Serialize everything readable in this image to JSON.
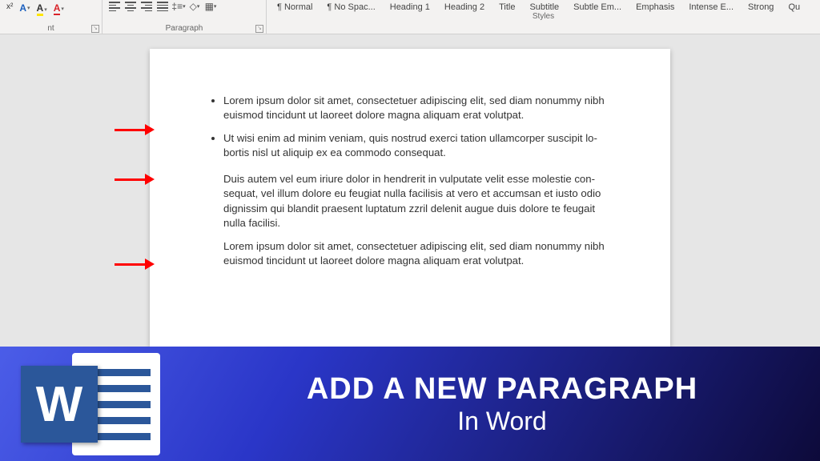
{
  "ribbon": {
    "font": {
      "x2": "x²",
      "label": "nt"
    },
    "paragraph": {
      "label": "Paragraph"
    },
    "styles": {
      "label": "Styles",
      "items": [
        "¶ Normal",
        "¶ No Spac...",
        "Heading 1",
        "Heading 2",
        "Title",
        "Subtitle",
        "Subtle Em...",
        "Emphasis",
        "Intense E...",
        "Strong",
        "Qu"
      ]
    }
  },
  "document": {
    "bullets": [
      "Lorem ipsum dolor sit amet, consectetuer adipiscing elit, sed diam nonummy nibh euismod tincidunt ut laoreet dolore magna aliquam erat volutpat.",
      "Ut wisi enim ad minim veniam, quis nostrud exerci tation ullamcorper suscipit lo-bortis nisl ut aliquip ex ea commodo consequat."
    ],
    "paras": [
      "Duis autem vel eum iriure dolor in hendrerit in vulputate velit esse molestie con-sequat, vel illum dolore eu feugiat nulla facilisis at vero et accumsan et iusto odio dignissim qui blandit praesent luptatum zzril delenit augue duis dolore te feugait nulla facilisi.",
      "Lorem ipsum dolor sit amet, consectetuer adipiscing elit, sed diam nonummy nibh euismod tincidunt ut laoreet dolore magna aliquam erat volutpat."
    ]
  },
  "banner": {
    "logo_letter": "W",
    "title": "ADD A NEW PARAGRAPH",
    "subtitle": "In Word"
  }
}
